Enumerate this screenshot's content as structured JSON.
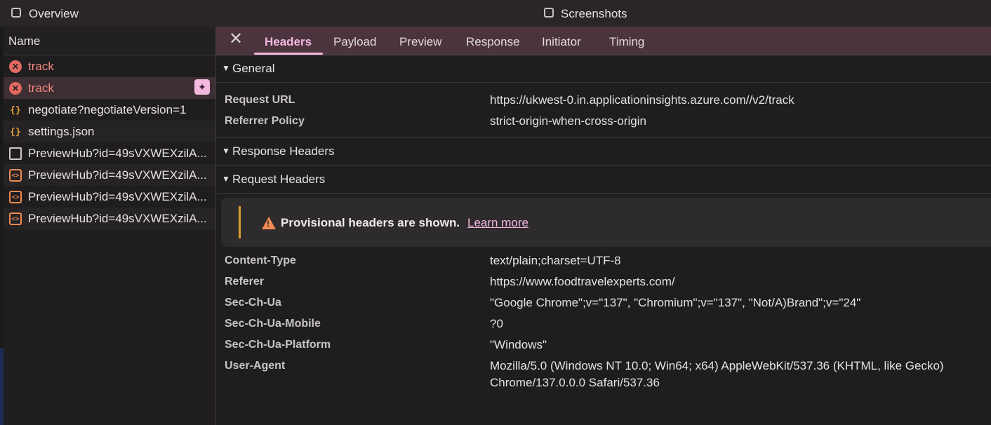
{
  "topbar": {
    "overview_label": "Overview",
    "screenshots_label": "Screenshots"
  },
  "request_list": {
    "header": "Name",
    "items": [
      {
        "label": "track",
        "icon": "error-icon",
        "status": "error"
      },
      {
        "label": "track",
        "icon": "error-icon",
        "status": "error",
        "selected": true
      },
      {
        "label": "negotiate?negotiateVersion=1",
        "icon": "json-icon"
      },
      {
        "label": "settings.json",
        "icon": "json-icon"
      },
      {
        "label": "PreviewHub?id=49sVXWEXzilA...",
        "icon": "document-icon"
      },
      {
        "label": "PreviewHub?id=49sVXWEXzilA...",
        "icon": "websocket-icon"
      },
      {
        "label": "PreviewHub?id=49sVXWEXzilA...",
        "icon": "websocket-icon"
      },
      {
        "label": "PreviewHub?id=49sVXWEXzilA...",
        "icon": "websocket-icon"
      }
    ]
  },
  "tabs": [
    {
      "label": "Headers",
      "active": true
    },
    {
      "label": "Payload"
    },
    {
      "label": "Preview"
    },
    {
      "label": "Response"
    },
    {
      "label": "Initiator"
    },
    {
      "label": "Timing"
    }
  ],
  "sections": {
    "general": "General",
    "response_headers": "Response Headers",
    "request_headers": "Request Headers"
  },
  "general": [
    {
      "key": "Request URL",
      "value": "https://ukwest-0.in.applicationinsights.azure.com//v2/track"
    },
    {
      "key": "Referrer Policy",
      "value": "strict-origin-when-cross-origin"
    }
  ],
  "warning": {
    "text": "Provisional headers are shown.",
    "link": "Learn more"
  },
  "request_headers": [
    {
      "key": "Content-Type",
      "value": "text/plain;charset=UTF-8"
    },
    {
      "key": "Referer",
      "value": "https://www.foodtravelexperts.com/"
    },
    {
      "key": "Sec-Ch-Ua",
      "value": "\"Google Chrome\";v=\"137\", \"Chromium\";v=\"137\", \"Not/A)Brand\";v=\"24\""
    },
    {
      "key": "Sec-Ch-Ua-Mobile",
      "value": "?0"
    },
    {
      "key": "Sec-Ch-Ua-Platform",
      "value": "\"Windows\""
    },
    {
      "key": "User-Agent",
      "value": "Mozilla/5.0 (Windows NT 10.0; Win64; x64) AppleWebKit/537.36 (KHTML, like Gecko)",
      "value_line2": "Chrome/137.0.0.0 Safari/537.36"
    }
  ],
  "colors": {
    "accent": "#f5b8de",
    "error": "#e46962",
    "warning": "#d9a230",
    "tabbar": "#4b343e"
  }
}
